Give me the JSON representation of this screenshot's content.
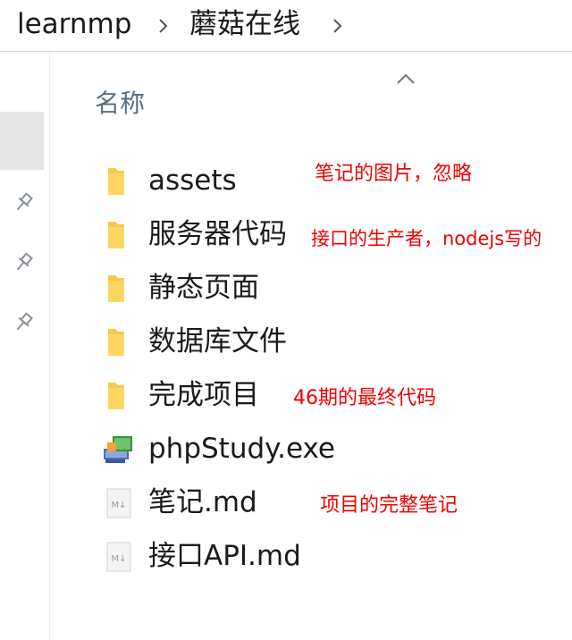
{
  "breadcrumb": {
    "items": [
      "learnmp",
      "蘑菇在线"
    ]
  },
  "column_header": {
    "name_label": "名称"
  },
  "files": [
    {
      "name": "assets",
      "type": "folder"
    },
    {
      "name": "服务器代码",
      "type": "folder"
    },
    {
      "name": "静态页面",
      "type": "folder"
    },
    {
      "name": "数据库文件",
      "type": "folder"
    },
    {
      "name": "完成项目",
      "type": "folder"
    },
    {
      "name": "phpStudy.exe",
      "type": "exe"
    },
    {
      "name": "笔记.md",
      "type": "markdown"
    },
    {
      "name": "接口API.md",
      "type": "markdown"
    }
  ],
  "annotations": {
    "assets": "笔记的图片，忽略",
    "server": "接口的生产者，nodejs写的",
    "final": "46期的最终代码",
    "notes": "项目的完整笔记"
  },
  "icons": {
    "breadcrumb_separator": "chevron-right-icon",
    "sort": "chevron-up-icon",
    "pin": "pin-icon",
    "folder": "folder-icon",
    "exe": "application-icon",
    "markdown": "markdown-file-icon"
  },
  "colors": {
    "folder": "#f7c948",
    "annotation": "#f20000",
    "header_text": "#5a6c80",
    "selection": "#e6e6e6"
  }
}
